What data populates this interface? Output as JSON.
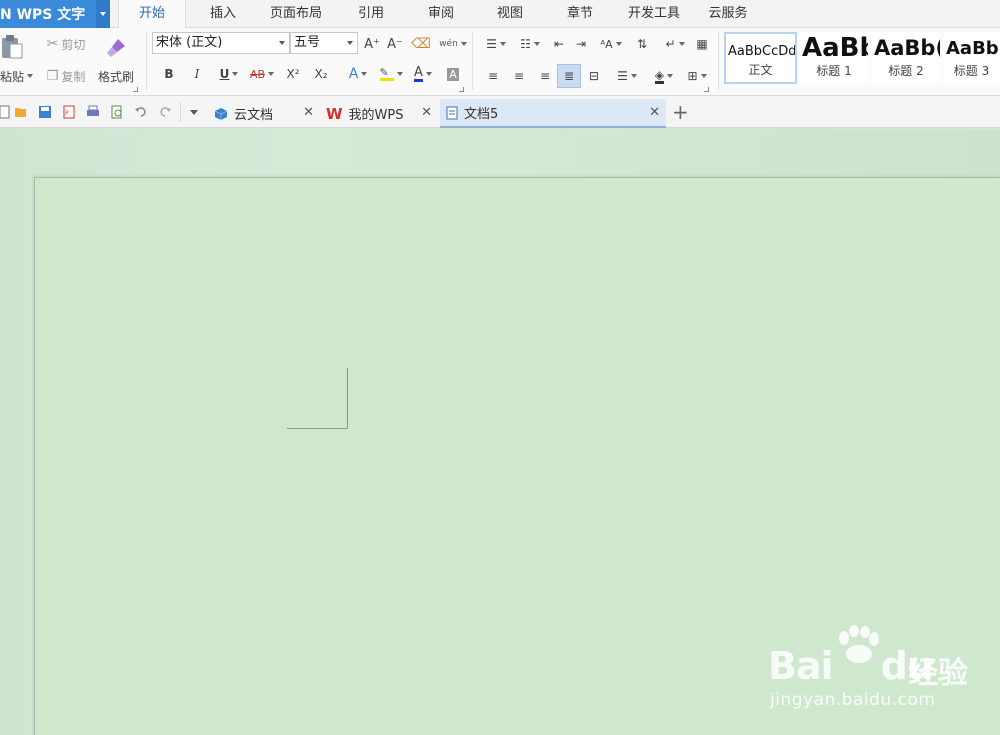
{
  "app": {
    "title": "N WPS 文字"
  },
  "menu": {
    "tabs": [
      {
        "label": "开始",
        "active": true
      },
      {
        "label": "插入"
      },
      {
        "label": "页面布局"
      },
      {
        "label": "引用"
      },
      {
        "label": "审阅"
      },
      {
        "label": "视图"
      },
      {
        "label": "章节"
      },
      {
        "label": "开发工具"
      },
      {
        "label": "云服务"
      }
    ]
  },
  "ribbon": {
    "clipboard": {
      "paste": "粘贴",
      "cut": "剪切",
      "copy": "复制",
      "format_painter": "格式刷"
    },
    "font": {
      "family": "宋体 (正文)",
      "size": "五号",
      "bold": "B",
      "italic": "I",
      "underline": "U",
      "strike": "AB",
      "superscript": "X²",
      "subscript": "X₂",
      "text_effect": "A",
      "font_color": "A",
      "char_shading": "A",
      "grow": "A⁺",
      "shrink": "A⁻",
      "pinyin": "wén"
    },
    "styles": [
      {
        "sample": "AaBbCcDd",
        "name": "正文",
        "selected": true
      },
      {
        "sample": "AaBb",
        "name": "标题 1"
      },
      {
        "sample": "AaBb(",
        "name": "标题 2"
      },
      {
        "sample": "AaBbC",
        "name": "标题 3"
      }
    ]
  },
  "quick_access": {
    "icons": [
      "new-icon",
      "open-icon",
      "save-icon",
      "export-pdf-icon",
      "print-icon",
      "print-preview-icon",
      "undo-icon",
      "redo-icon",
      "customize-icon"
    ]
  },
  "doc_tabs": [
    {
      "label": "云文档",
      "icon": "cloud-box-icon"
    },
    {
      "label": "我的WPS",
      "icon": "wps-logo-icon"
    },
    {
      "label": "文档5",
      "icon": "document-icon",
      "active": true
    }
  ],
  "watermark": {
    "brand": "Bai",
    "brand_tail": "du",
    "cn": "经验",
    "url": "jingyan.baidu.com"
  },
  "colors": {
    "accent": "#3b8ad9",
    "active_tab_text": "#2d6bb5",
    "page_bg": "#cfe8cd",
    "workspace_bg": "#d3e8d5"
  }
}
